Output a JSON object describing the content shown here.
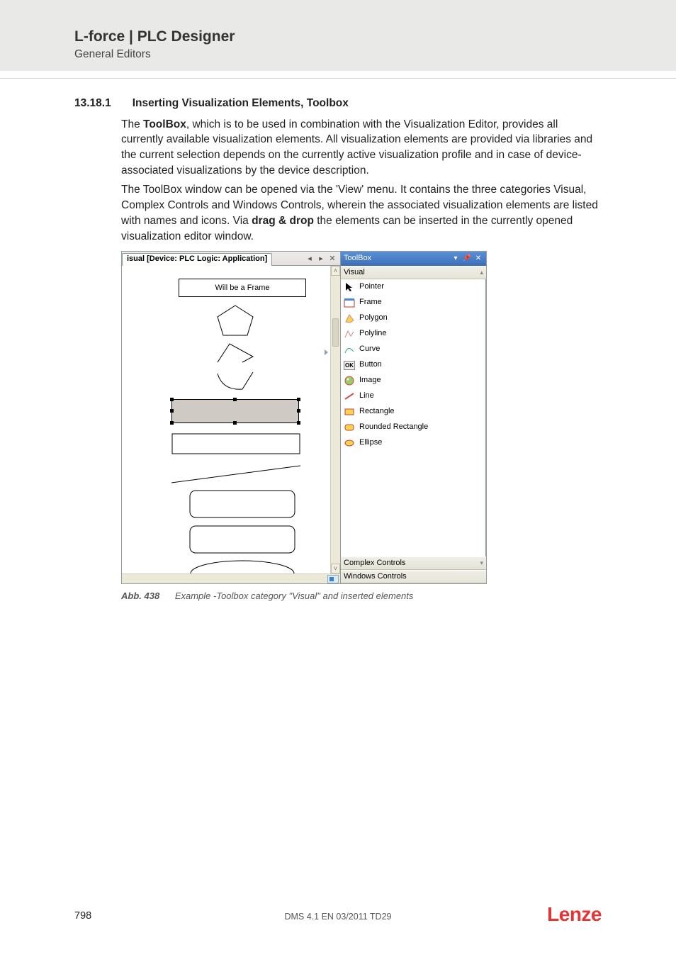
{
  "header": {
    "title": "L-force | PLC Designer",
    "subtitle": "General Editors"
  },
  "section": {
    "number": "13.18.1",
    "title": "Inserting Visualization Elements, Toolbox",
    "p1": {
      "a": "The ",
      "bold1": "ToolBox",
      "b": ", which is to be used in combination with the Visualization Editor, provides all currently available visualization elements. All visualization elements are provided via libraries and the current selection depends on the currently active visualization profile and in case of device-associated visualizations by the device description."
    },
    "p2": {
      "a": "The ToolBox window can be opened via the 'View' menu. It contains the three categories Visual, Complex Controls and Windows Controls, wherein the associated  visualization elements are listed with names and icons. Via ",
      "bold1": "drag & drop",
      "b": " the elements can be inserted in the currently opened visualization editor window."
    },
    "caption": {
      "label": "Abb. 438",
      "text": "Example -Toolbox category \"Visual\" and inserted elements"
    }
  },
  "screenshot": {
    "editor": {
      "tab_label": "isual [Device: PLC Logic: Application]",
      "frame_label": "Will be a Frame"
    },
    "toolbox": {
      "title": "ToolBox",
      "categories": [
        "Visual",
        "Complex Controls",
        "Windows Controls"
      ],
      "items": [
        "Pointer",
        "Frame",
        "Polygon",
        "Polyline",
        "Curve",
        "Button",
        "Image",
        "Line",
        "Rectangle",
        "Rounded Rectangle",
        "Ellipse"
      ]
    }
  },
  "footer": {
    "page": "798",
    "doc_id": "DMS 4.1 EN 03/2011 TD29",
    "brand": "Lenze"
  }
}
